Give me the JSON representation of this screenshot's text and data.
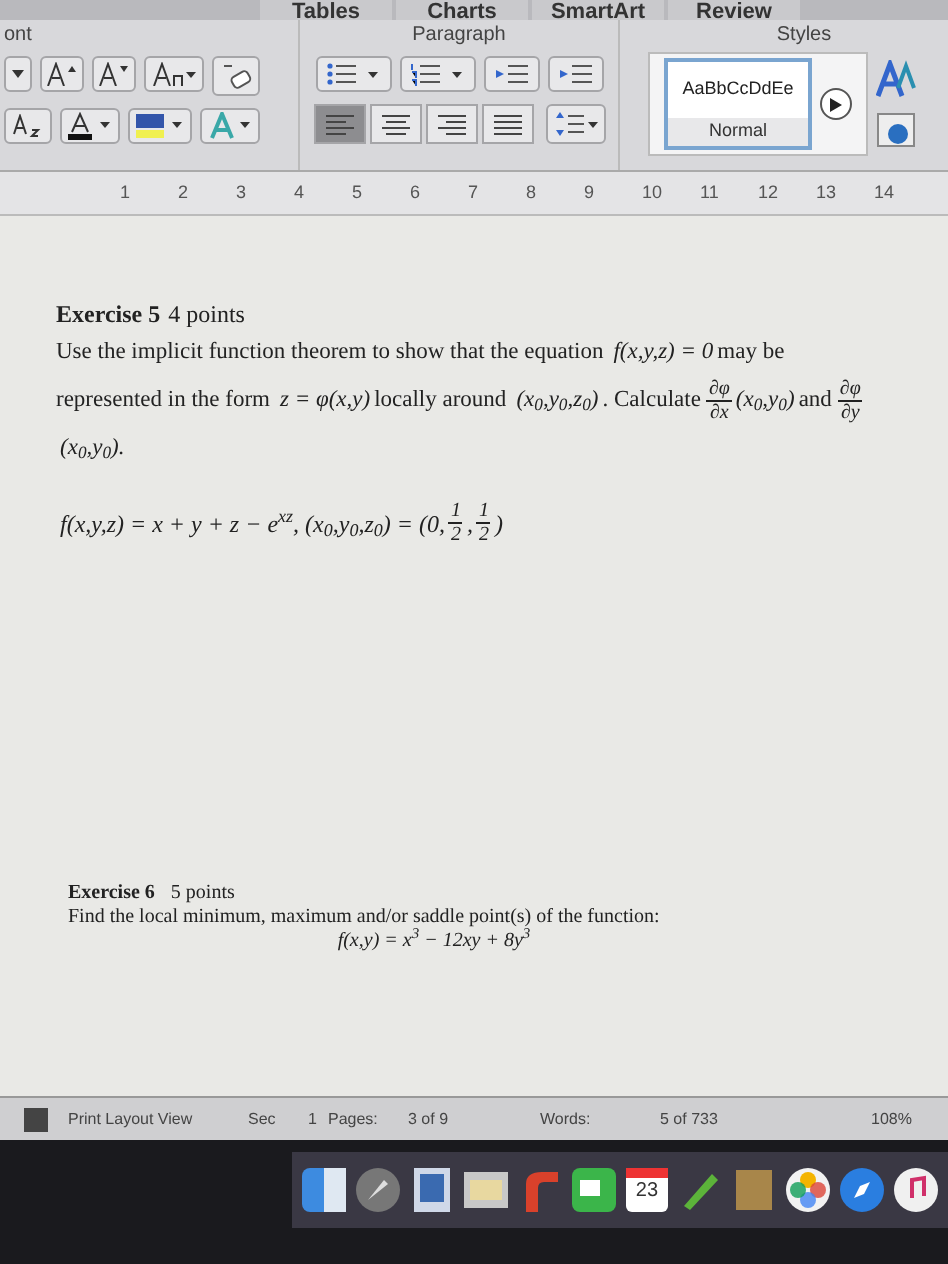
{
  "tabs": [
    {
      "label": "Tables",
      "selected": false
    },
    {
      "label": "Charts",
      "selected": false
    },
    {
      "label": "SmartArt",
      "selected": false
    },
    {
      "label": "Review",
      "selected": false
    }
  ],
  "ribbon": {
    "groups": [
      "ont",
      "Paragraph",
      "Styles"
    ],
    "style_preview": "AaBbCcDdEe",
    "style_name": "Normal",
    "align_buttons": [
      {
        "selected": true
      },
      {
        "selected": false
      },
      {
        "selected": false
      },
      {
        "selected": false
      }
    ]
  },
  "ruler": [
    "1",
    "2",
    "3",
    "4",
    "5",
    "6",
    "7",
    "8",
    "9",
    "10",
    "11",
    "12",
    "13",
    "14"
  ],
  "exercise_5": {
    "heading": "Exercise 5",
    "points": "4 points",
    "body": [
      {
        "kind": "text",
        "text": "Use the implicit function theorem to show that the equation "
      },
      {
        "kind": "math",
        "text": "f(x,y,z) = 0"
      },
      {
        "kind": "text",
        "text": "may be"
      },
      {
        "kind": "text",
        "text": "represented in the form "
      },
      {
        "kind": "math",
        "text": "z = φ(x,y)"
      },
      {
        "kind": "text",
        "text": "locally around "
      },
      {
        "kind": "math",
        "text": "(x$_{0}$,y$_{0}$,z$_{0}$)"
      },
      {
        "kind": "text",
        "text": ". Calculate "
      },
      {
        "kind": "frac",
        "num": "∂φ",
        "den": "∂x"
      },
      {
        "kind": "math",
        "text": "(x$_{0}$,y$_{0}$)"
      },
      {
        "kind": "text",
        "text": "and"
      },
      {
        "kind": "frac",
        "num": "∂φ",
        "den": "∂y"
      },
      {
        "kind": "math",
        "text": "(x$_{0}$,y$_{0}$)."
      }
    ],
    "formula": [
      {
        "kind": "math",
        "text": "f(x,y,z) = x + y + z − e$^{xz}$, (x$_{0}$,y$_{0}$,z$_{0}$) = (0,"
      },
      {
        "kind": "frac",
        "num": "1",
        "den": "2"
      },
      {
        "kind": "math",
        "text": ","
      },
      {
        "kind": "frac",
        "num": "1",
        "den": "2"
      },
      {
        "kind": "math",
        "text": ")"
      }
    ]
  },
  "exercise_6": {
    "heading": "Exercise 6",
    "points": "5 points",
    "text": "Find the local minimum, maximum and/or saddle point(s) of the function:",
    "formula": "f(x,y) = x$^{3}$ − 12xy + 8y$^{3}$"
  },
  "status_bar": {
    "view": "Print Layout View",
    "section_label": "Sec",
    "section": "1",
    "pages_label": "Pages:",
    "pages": "3 of 9",
    "words_label": "Words:",
    "words": "5 of 733",
    "zoom": "108%"
  },
  "dock": {
    "calendar_day": "23"
  }
}
